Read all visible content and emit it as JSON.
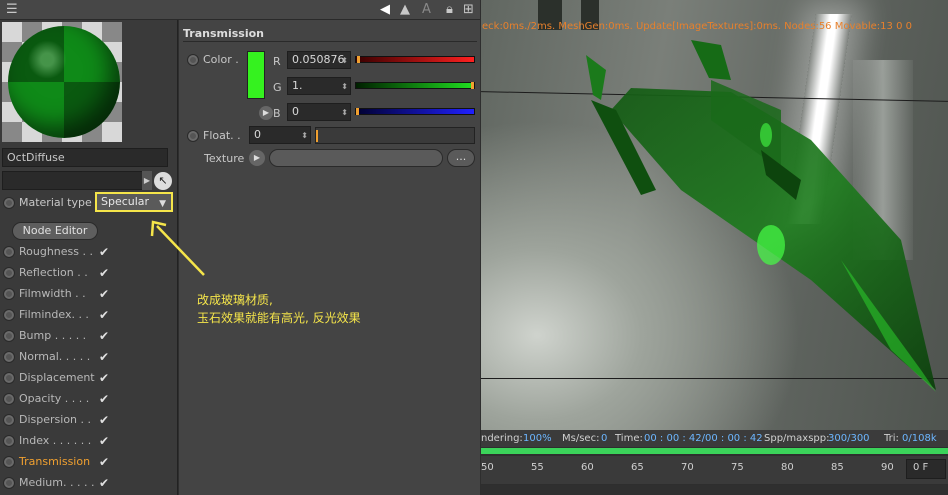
{
  "left_panel": {
    "material_name": "OctDiffuse",
    "material_type_label": "Material type",
    "material_type_value": "Specular",
    "node_editor_label": "Node Editor",
    "channels": [
      {
        "label": "Roughness . .",
        "checked": true
      },
      {
        "label": "Reflection . .",
        "checked": true
      },
      {
        "label": "Filmwidth . .",
        "checked": true
      },
      {
        "label": "Filmindex. . .",
        "checked": true
      },
      {
        "label": "Bump . . . . .",
        "checked": true
      },
      {
        "label": "Normal. . . . .",
        "checked": true
      },
      {
        "label": "Displacement",
        "checked": true
      },
      {
        "label": "Opacity . . . .",
        "checked": true
      },
      {
        "label": "Dispersion . .",
        "checked": true
      },
      {
        "label": "Index . . . . . .",
        "checked": true
      },
      {
        "label": "Transmission",
        "checked": true,
        "active": true
      },
      {
        "label": "Medium. . . . .",
        "checked": true
      }
    ]
  },
  "attributes": {
    "section_title": "Transmission",
    "color_label": "Color .",
    "color_hex": "#35f21f",
    "r_label": "R",
    "r_value": "0.050876",
    "g_label": "G",
    "g_value": "1.",
    "b_label": "B",
    "b_value": "0",
    "float_label": "Float. .",
    "float_value": "0",
    "texture_label": "Texture",
    "more_button": "..."
  },
  "annotation": {
    "line1": "改成玻璃材质,",
    "line2": "玉石效果就能有高光, 反光效果",
    "color": "#f5e54a"
  },
  "viewport": {
    "status_text": "eck:0ms./2ms. MeshGen:0ms. Update[ImageTextures]:0ms. Nodes:56 Movable:13 0 0"
  },
  "stats": {
    "rendering_label": "ndering:",
    "rendering_value": "100%",
    "ms_label": "Ms/sec:",
    "ms_value": "0",
    "time_label": "Time:",
    "time_value": "00 : 00 : 42/00 : 00 : 42",
    "spp_label": "Spp/maxspp:",
    "spp_value": "300/300",
    "tri_label": "Tri:",
    "tri_value": "0/108k"
  },
  "timeline": {
    "ticks": [
      "50",
      "55",
      "60",
      "65",
      "70",
      "75",
      "80",
      "85",
      "90"
    ],
    "frame_value": "0 F"
  }
}
